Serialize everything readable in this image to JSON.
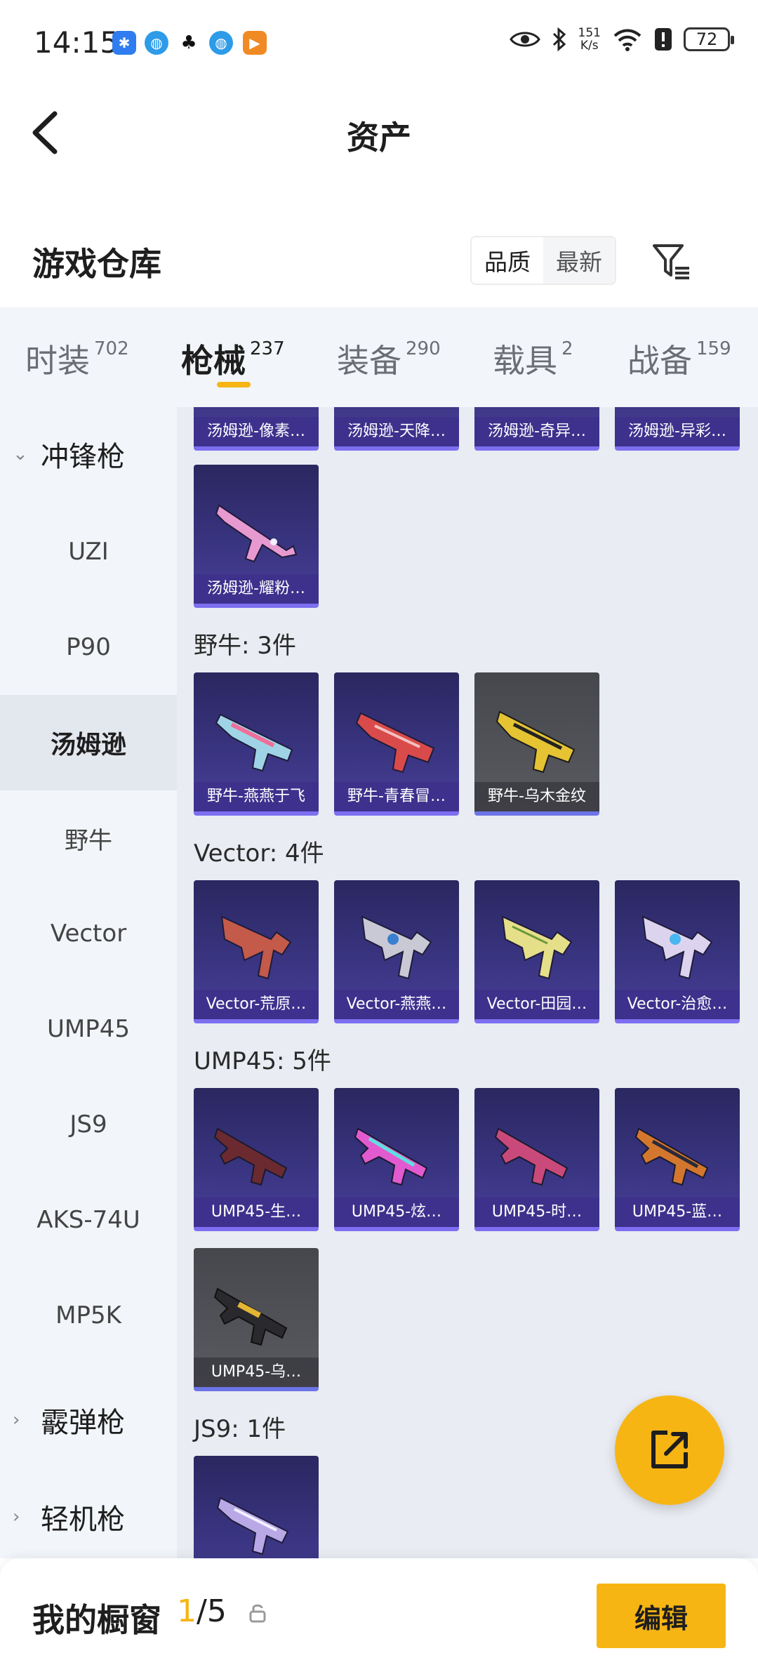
{
  "status_bar": {
    "time": "14:15",
    "network_speed_value": "151",
    "network_speed_unit": "K/s",
    "battery": "72",
    "notification_icons": [
      "bluetooth-app-icon",
      "browser-icon",
      "qq-icon",
      "browser-icon",
      "media-app-icon"
    ]
  },
  "header": {
    "title": "资产"
  },
  "warehouse": {
    "title": "游戏仓库",
    "sort_options": [
      "品质",
      "最新"
    ],
    "active_sort": "品质"
  },
  "tabs": [
    {
      "label": "时装",
      "count": "702"
    },
    {
      "label": "枪械",
      "count": "237"
    },
    {
      "label": "装备",
      "count": "290"
    },
    {
      "label": "载具",
      "count": "2"
    },
    {
      "label": "战备",
      "count": "159"
    }
  ],
  "active_tab": "枪械",
  "sidebar": {
    "category_open": "冲锋枪",
    "items": [
      "UZI",
      "P90",
      "汤姆逊",
      "野牛",
      "Vector",
      "UMP45",
      "JS9",
      "AKS-74U",
      "MP5K"
    ],
    "active_item": "汤姆逊",
    "categories_collapsed": [
      "霰弹枪",
      "轻机枪"
    ]
  },
  "sections": [
    {
      "title": "",
      "cards": [
        {
          "name": "汤姆逊-像素…",
          "style": "purple"
        },
        {
          "name": "汤姆逊-天降…",
          "style": "purple"
        },
        {
          "name": "汤姆逊-奇异…",
          "style": "purple"
        },
        {
          "name": "汤姆逊-异彩…",
          "style": "purple"
        },
        {
          "name": "汤姆逊-耀粉…",
          "style": "purple"
        }
      ]
    },
    {
      "title": "野牛: 3件",
      "cards": [
        {
          "name": "野牛-燕燕于飞",
          "style": "purple"
        },
        {
          "name": "野牛-青春冒…",
          "style": "purple"
        },
        {
          "name": "野牛-乌木金纹",
          "style": "gray"
        }
      ]
    },
    {
      "title": "Vector: 4件",
      "cards": [
        {
          "name": "Vector-荒原…",
          "style": "purple"
        },
        {
          "name": "Vector-燕燕…",
          "style": "purple"
        },
        {
          "name": "Vector-田园…",
          "style": "purple"
        },
        {
          "name": "Vector-治愈…",
          "style": "purple"
        }
      ]
    },
    {
      "title": "UMP45: 5件",
      "cards": [
        {
          "name": "UMP45-生…",
          "style": "purple"
        },
        {
          "name": "UMP45-炫…",
          "style": "purple"
        },
        {
          "name": "UMP45-时…",
          "style": "purple"
        },
        {
          "name": "UMP45-蓝…",
          "style": "purple"
        },
        {
          "name": "UMP45-乌…",
          "style": "gray"
        }
      ]
    },
    {
      "title": "JS9: 1件",
      "cards": [
        {
          "name": "",
          "style": "purple"
        }
      ]
    }
  ],
  "showcase": {
    "title": "我的橱窗",
    "current": "1",
    "separator_total": "/5",
    "edit_label": "编辑"
  },
  "colors": {
    "accent": "#f7b514",
    "card_purple": "#3a3582",
    "card_gray": "#55565c",
    "sidebar_bg": "#f2f5f9",
    "grid_bg": "#e9ecf2"
  }
}
